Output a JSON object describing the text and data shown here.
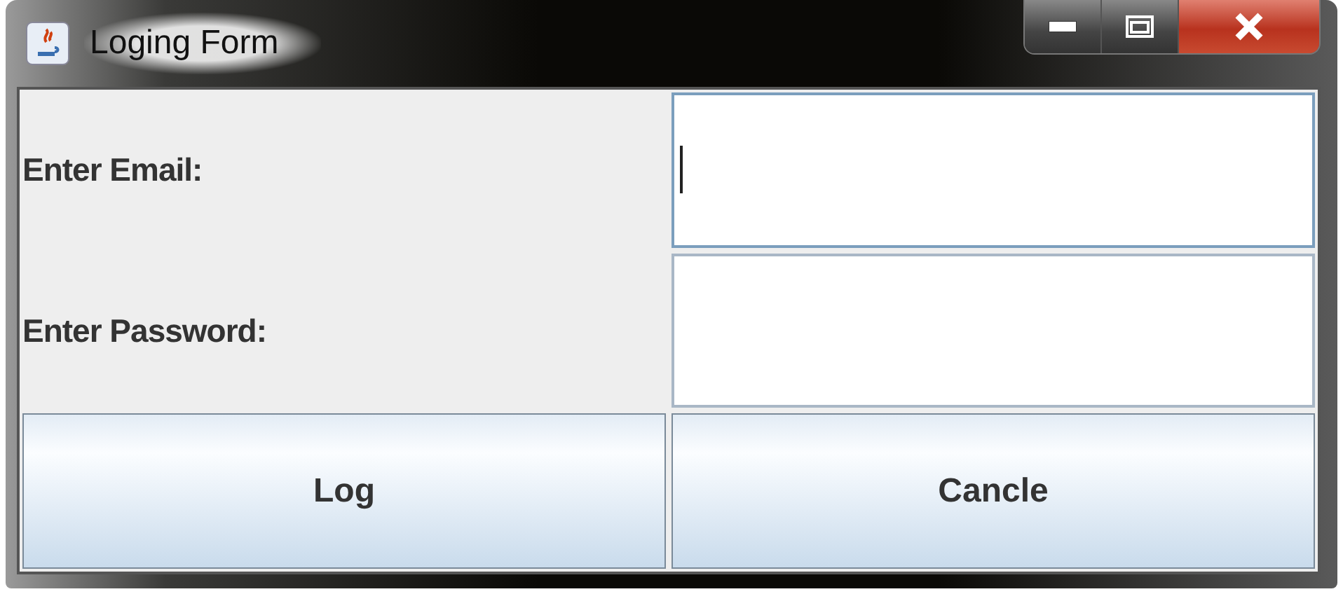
{
  "window": {
    "title": "Loging Form"
  },
  "fields": [
    {
      "label": "Enter Email:",
      "focused": true
    },
    {
      "label": "Enter Password:",
      "focused": false
    }
  ],
  "buttons": [
    "Log",
    "Cancle"
  ]
}
